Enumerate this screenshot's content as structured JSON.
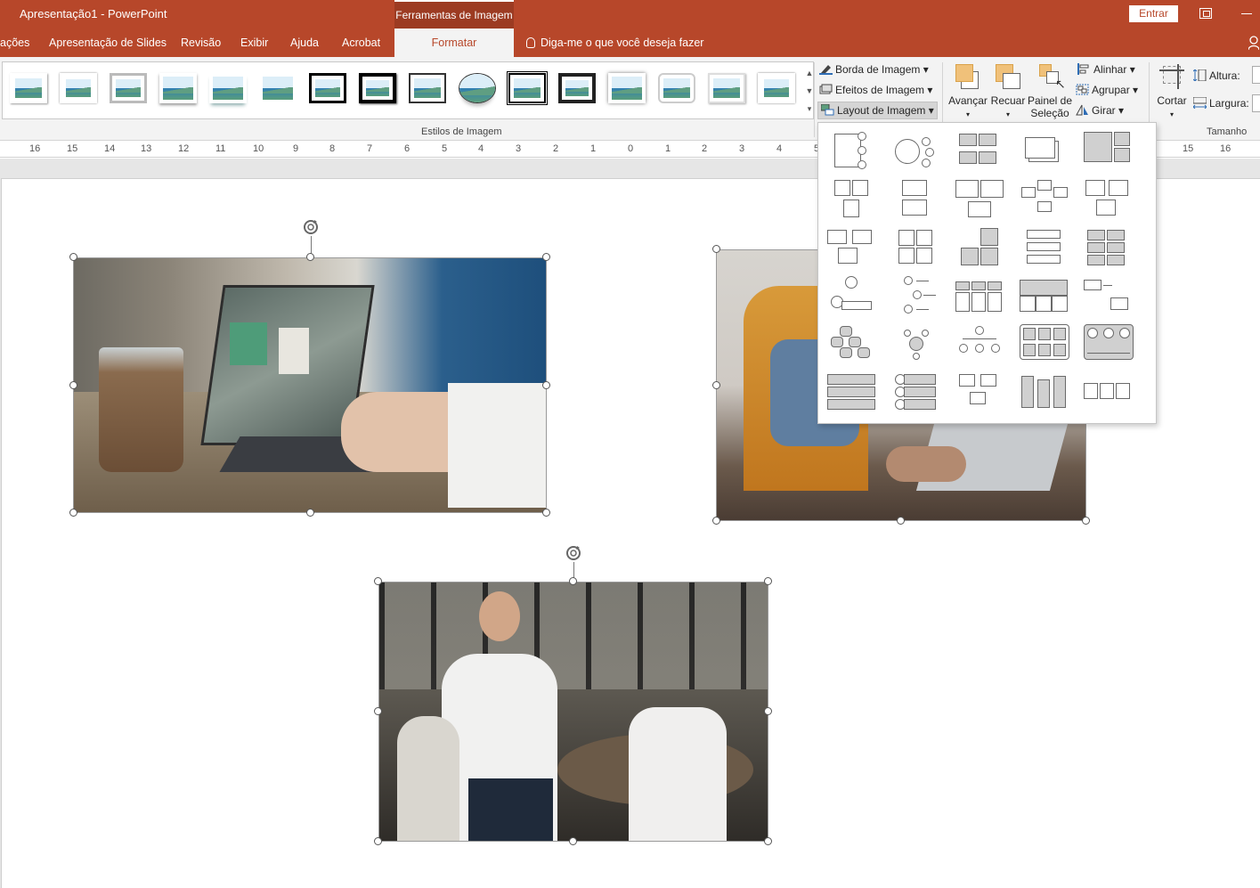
{
  "window": {
    "title": "Apresentação1  -  PowerPoint",
    "context_tab": "Ferramentas de Imagem",
    "login_button": "Entrar"
  },
  "tabs": [
    {
      "label": "ações"
    },
    {
      "label": "Apresentação de Slides"
    },
    {
      "label": "Revisão"
    },
    {
      "label": "Exibir"
    },
    {
      "label": "Ajuda"
    },
    {
      "label": "Acrobat"
    },
    {
      "label": "Formatar"
    }
  ],
  "tell_me": "Diga-me o que você deseja fazer",
  "ribbon": {
    "styles_group_label": "Estilos de Imagem",
    "picture_border": "Borda de Imagem",
    "picture_effects": "Efeitos de Imagem",
    "picture_layout": "Layout de Imagem",
    "bring_forward": "Avançar",
    "send_backward": "Recuar",
    "selection_pane_line1": "Painel de",
    "selection_pane_line2": "Seleção",
    "align": "Alinhar",
    "group": "Agrupar",
    "rotate": "Girar",
    "crop": "Cortar",
    "height_label": "Altura:",
    "width_label": "Largura:",
    "size_group_label": "Tamanho"
  },
  "ruler": {
    "labels": [
      "16",
      "15",
      "14",
      "13",
      "12",
      "11",
      "10",
      "9",
      "8",
      "7",
      "6",
      "5",
      "4",
      "3",
      "2",
      "1",
      "0",
      "1",
      "2",
      "3",
      "4",
      "5",
      "15",
      "16"
    ]
  },
  "colors": {
    "accent": "#b7472a",
    "ribbon_bg": "#f3f3f3"
  },
  "slide_photos": [
    {
      "name": "laptop-photo",
      "description_icon": "image-icon"
    },
    {
      "name": "man-laptop-photo",
      "description_icon": "image-icon"
    },
    {
      "name": "office-team-photo",
      "description_icon": "image-icon"
    }
  ]
}
